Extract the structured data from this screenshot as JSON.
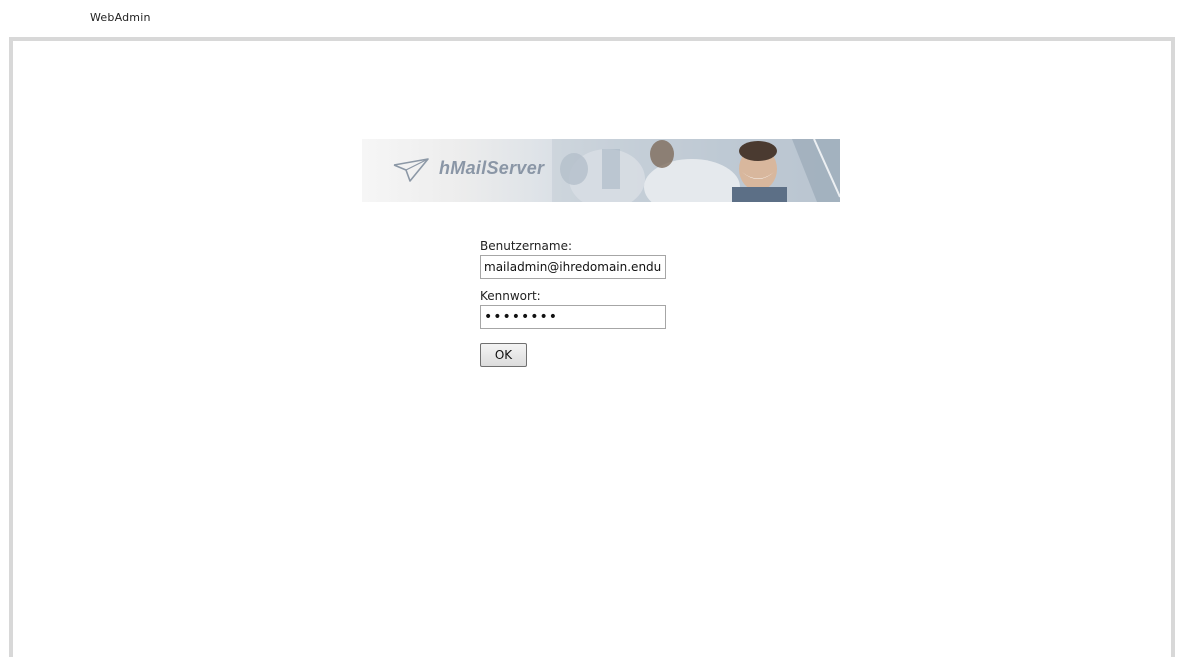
{
  "header": {
    "title": "WebAdmin"
  },
  "banner": {
    "brand_name": "hMailServer",
    "logo_icon": "paper-plane-icon"
  },
  "login_form": {
    "username_label": "Benutzername:",
    "username_value": "mailadmin@ihredomain.endung",
    "password_label": "Kennwort:",
    "password_value": "••••••••",
    "ok_label": "OK"
  },
  "colors": {
    "panel_border": "#d8d8d8",
    "brand_text": "#8a96a6"
  }
}
